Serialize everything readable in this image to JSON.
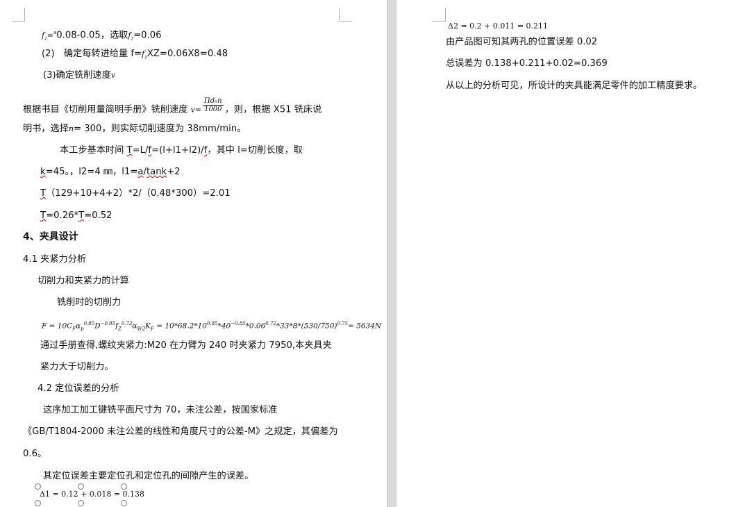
{
  "left": {
    "l1": {
      "sym": "f",
      "sub": "z",
      "eq": "=",
      "tiny": "a",
      "text": "0.08-0.05，选取",
      "sym2": "f",
      "sub2": "z",
      "tail": "=0.06"
    },
    "l2": {
      "prefix": "(2)　确定每转进给量 f=",
      "sym": "f",
      "sub": "z",
      "tail": "XZ=0.06X8=0.48"
    },
    "l3": {
      "text": "(3)确定铣削速度",
      "sym": "v"
    },
    "l4": {
      "text": "根据书目《切削用量简明手册》铣削速度",
      "v": "v",
      "eq": "=",
      "num": "Πd₀n",
      "den": "1000",
      "tail": "，则，根据 X51 铣床说"
    },
    "l5": {
      "text": "明书，选择",
      "sym": "n",
      "tail": "= 300，则实际切削速度为 38mm/min。"
    },
    "l6": {
      "a": "本工步基本时间 ",
      "b": "T",
      "c": "=L/",
      "d": "f",
      "e": "=(l+l1+l2)/",
      "f": "f",
      "g": "，其中 l=切削长度，取"
    },
    "l7": {
      "a": "k",
      "b": "=45。，l2=4 ㎜，l1=",
      "c": "a",
      "d": "/",
      "e": "tank",
      "f": "+2"
    },
    "l8": {
      "a": "T",
      "b": "（129+10+4+2）*2/（0.48*300）=2.01"
    },
    "l9": {
      "a": "T",
      "b": "=0.26*",
      "c": "T",
      "d": "=0.52"
    },
    "heading": "4、夹具设计",
    "s41": "4.1 夹紧力分析",
    "p1": "切削力和夹紧力的计算",
    "p2": "铣削时的切削力",
    "formula": {
      "lhs": "F = 10C",
      "mid": "D",
      "rest": " = 10*68.2*10",
      "e1": "0.85",
      "t1": "*40",
      "e2": "−0.85",
      "t2": "*0.06",
      "e3": "0.72",
      "t3": "*33*8*(530/750)",
      "e4": "0.75",
      "t4": "= 5634N"
    },
    "p3": "通过手册查得,螺纹夹紧力:M20 在力臂为 240 时夹紧力 7950,本夹具夹",
    "p4": "紧力大于切削力。",
    "s42": "4.2 定位误差的分析",
    "p5": "这序加工加工键铣平面尺寸为 70，未注公差，按国家标准",
    "p6": "《GB/T1804-2000 未注公差的线性和角度尺寸的公差-M》之规定，其偏差为",
    "p7": "0.6。",
    "p8": "其定位误差主要定位孔和定位孔的间隙产生的误差。",
    "eq1": "Δ1 = 0.12 + 0.018 = 0.138"
  },
  "right": {
    "eq2": "Δ2 = 0.2 + 0.011 = 0.211",
    "r1": "由产品图可知其两孔的位置误差 0.02",
    "r2": "总误差为 0.138+0.211+0.02=0.369",
    "r3": "从以上的分析可见，所设计的夹具能满足零件的加工精度要求。"
  }
}
